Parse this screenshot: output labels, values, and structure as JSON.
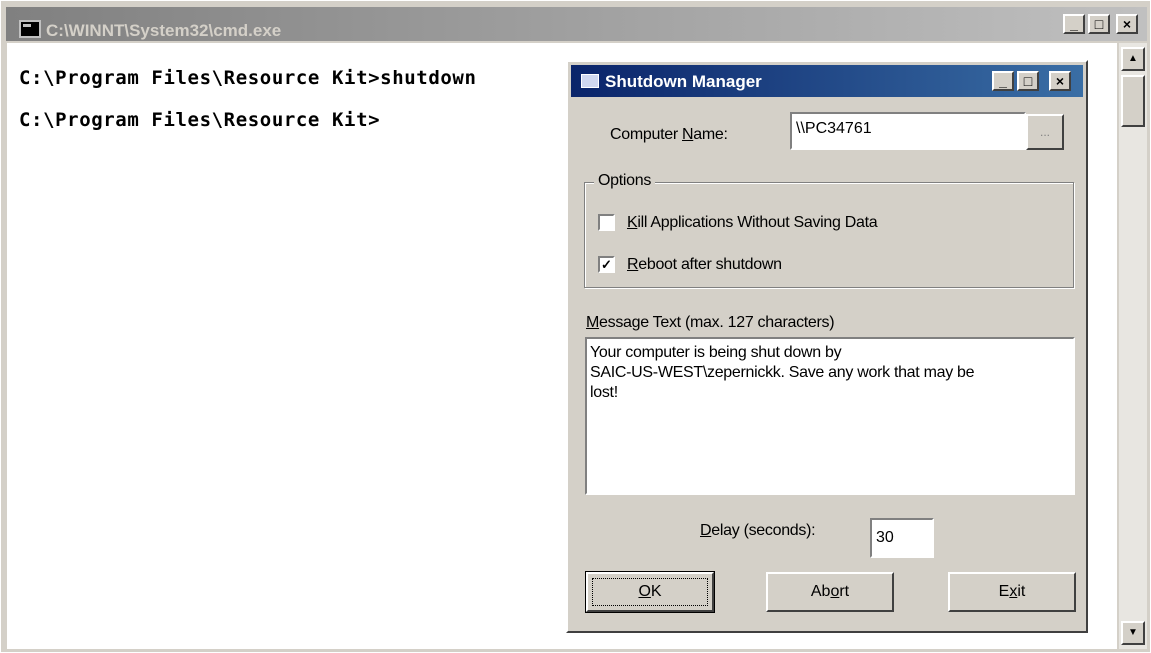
{
  "cmd": {
    "title": "C:\\WINNT\\System32\\cmd.exe",
    "lines": [
      "C:\\Program Files\\Resource Kit>shutdown",
      "C:\\Program Files\\Resource Kit>"
    ],
    "minimize_glyph": "_",
    "maximize_glyph": "□",
    "close_glyph": "×",
    "scroll_up_glyph": "▲",
    "scroll_down_glyph": "▼"
  },
  "dialog": {
    "title": "Shutdown Manager",
    "minimize_glyph": "_",
    "maximize_glyph": "□",
    "close_glyph": "×",
    "computer_name": {
      "label_pre": "Computer ",
      "label_mnemonic": "N",
      "label_post": "ame:",
      "value": "\\\\PC34761",
      "browse_label": "..."
    },
    "options": {
      "group_label": "Options",
      "kill_apps": {
        "label_mnemonic": "K",
        "label_rest": "ill Applications Without Saving Data",
        "checked": false
      },
      "reboot": {
        "label_mnemonic": "R",
        "label_rest": "eboot after shutdown",
        "checked": true,
        "check_glyph": "✓"
      }
    },
    "message": {
      "label_mnemonic": "M",
      "label_rest": "essage Text (max. 127 characters)",
      "lines": [
        "Your computer is being shut down by",
        "SAIC-US-WEST\\zepernickk.  Save any work that may be",
        "lost!"
      ]
    },
    "delay": {
      "label_mnemonic": "D",
      "label_rest": "elay (seconds):",
      "value": "30"
    },
    "buttons": {
      "ok": {
        "mnemonic": "O",
        "rest": "K"
      },
      "abort": {
        "pre": "Ab",
        "mnemonic": "o",
        "post": "rt"
      },
      "exit": {
        "pre": "E",
        "mnemonic": "x",
        "post": "it"
      }
    }
  },
  "colors": {
    "dialog_title_start": "#0a246a",
    "dialog_title_end": "#3a6ea5",
    "cmd_title_inactive": "#808080",
    "face": "#d4d0c8"
  }
}
